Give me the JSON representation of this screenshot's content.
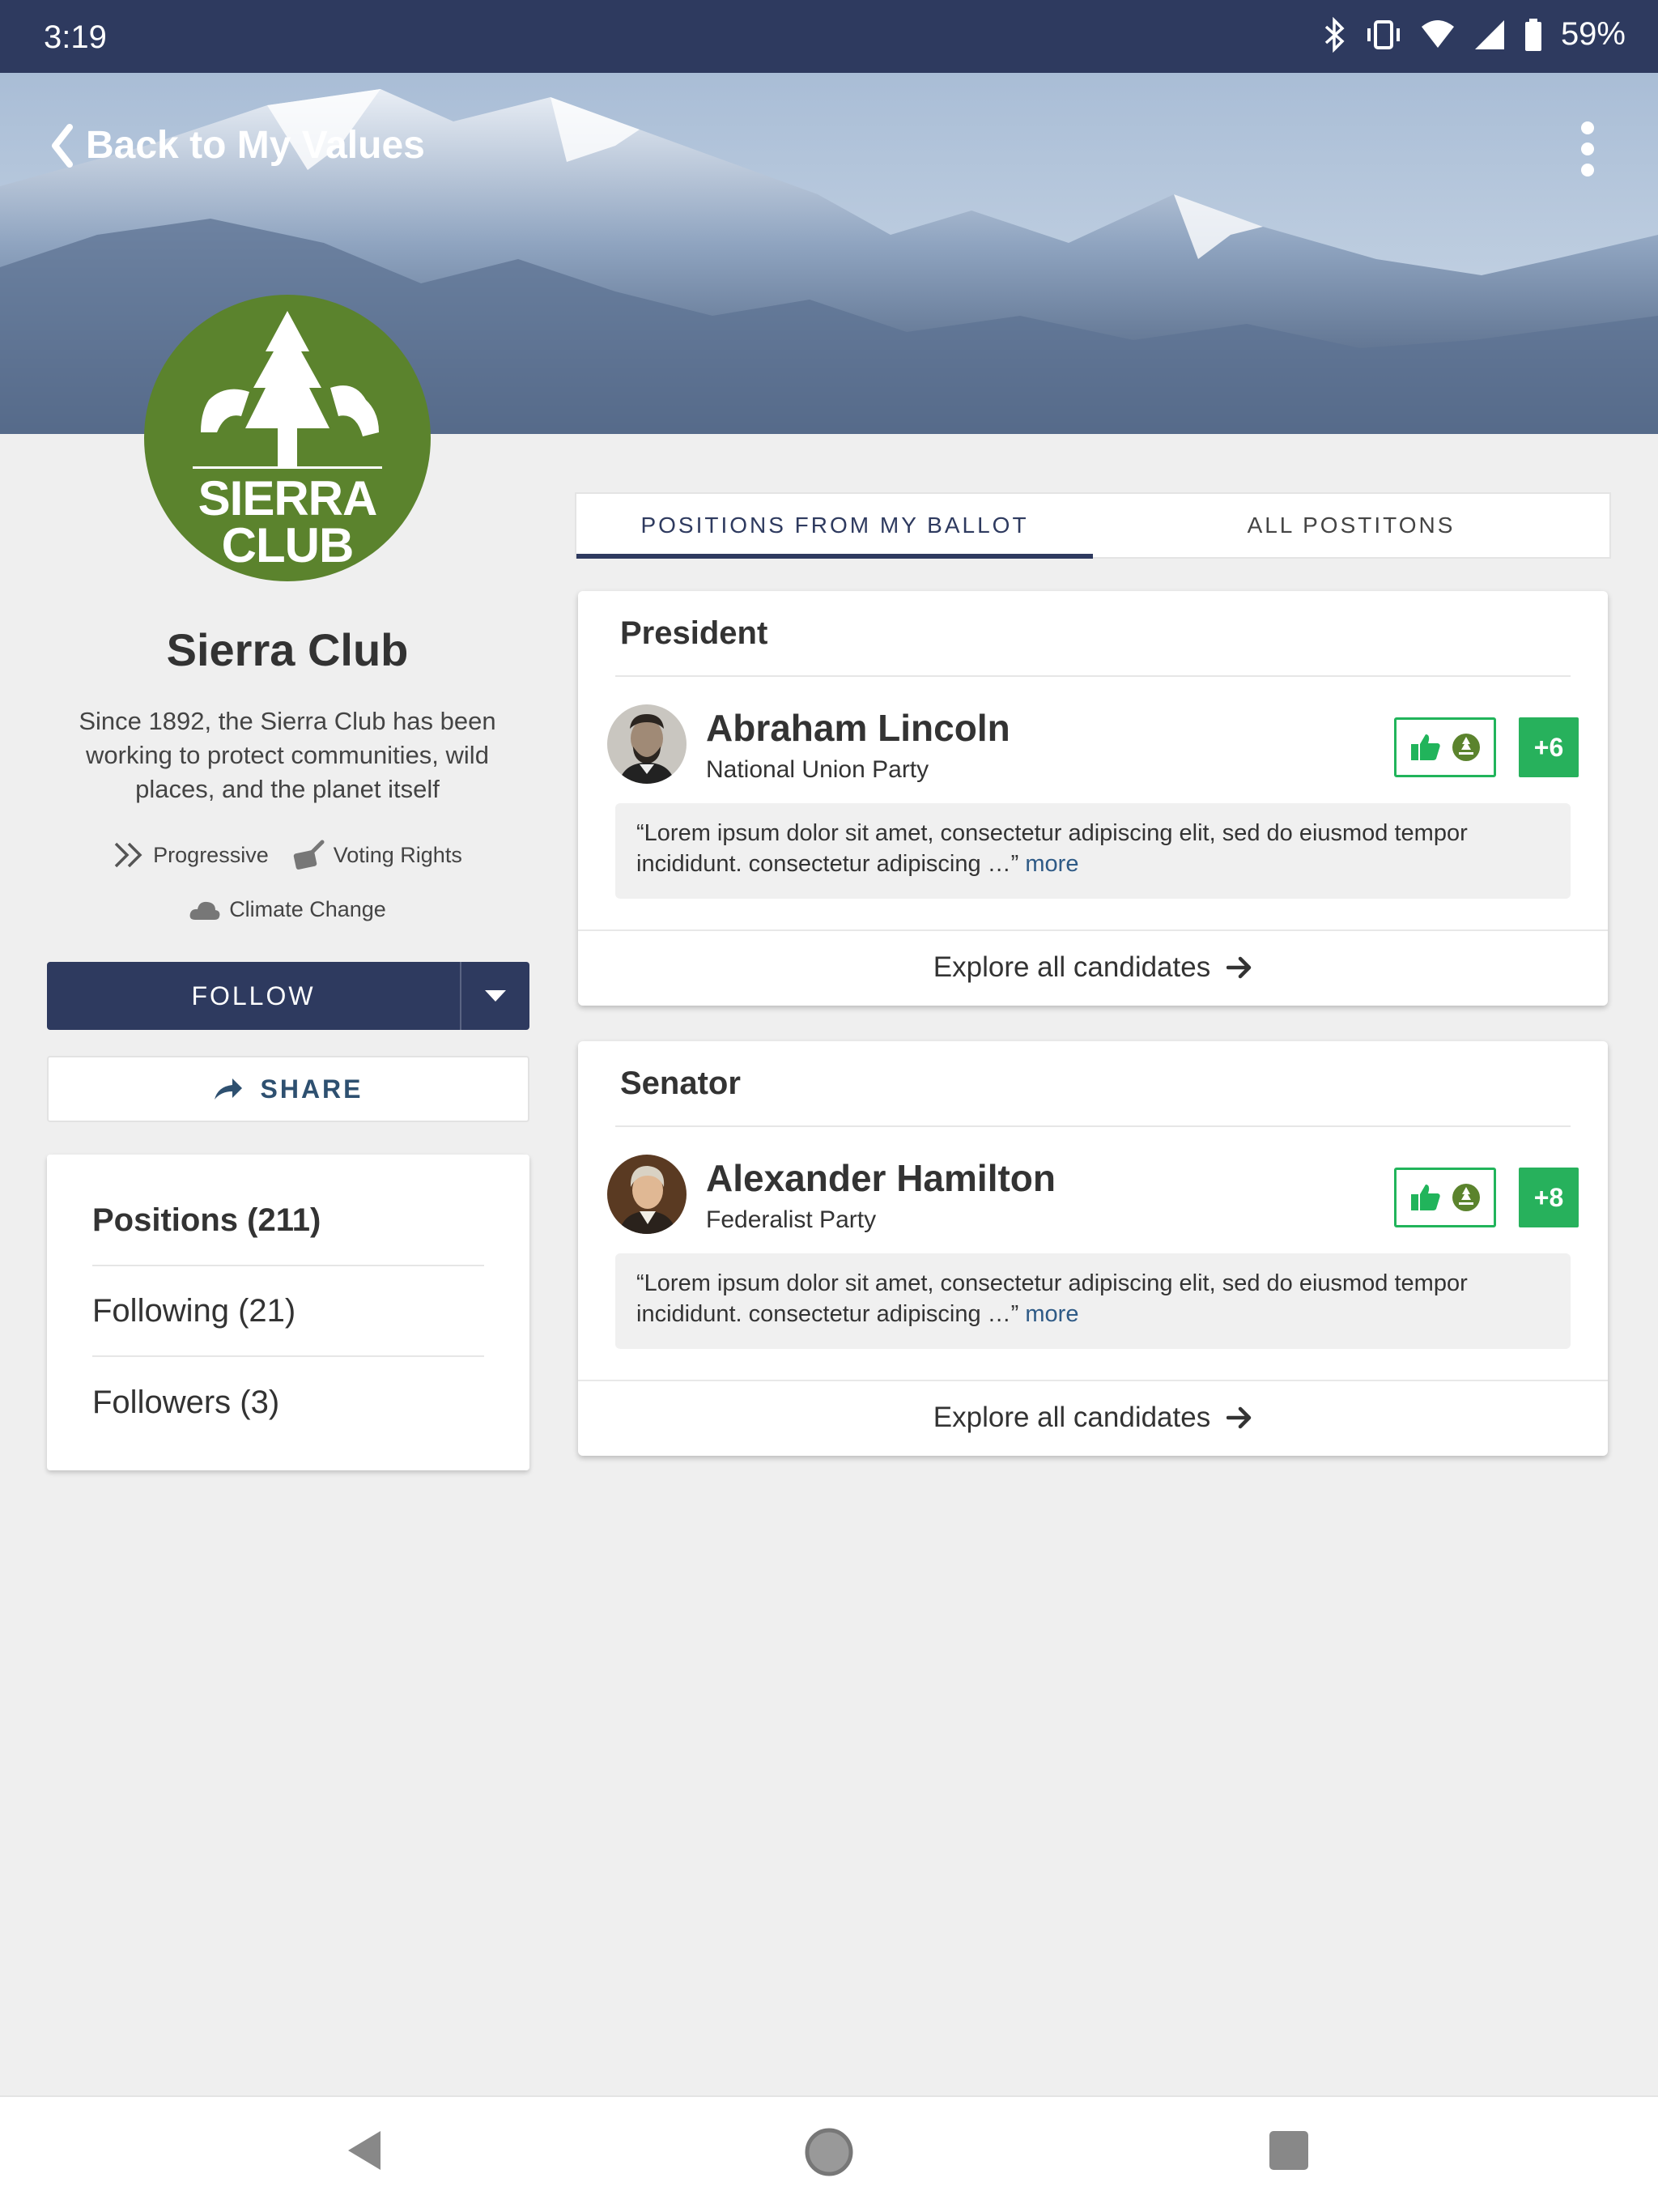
{
  "status_bar": {
    "time": "3:19",
    "battery": "59%"
  },
  "header": {
    "back_label": "Back to My Values"
  },
  "logo": {
    "line1": "SIERRA",
    "line2": "CLUB",
    "color": "#5b832d"
  },
  "organization": {
    "name": "Sierra Club",
    "description": "Since 1892, the Sierra Club has been working to protect communities, wild places, and the planet itself",
    "tags": [
      {
        "label": "Progressive",
        "icon": "double-chevron-icon"
      },
      {
        "label": "Voting Rights",
        "icon": "ballot-pen-icon"
      },
      {
        "label": "Climate Change",
        "icon": "cloud-icon"
      }
    ]
  },
  "actions": {
    "follow_label": "FOLLOW",
    "share_label": "SHARE"
  },
  "stats": {
    "positions": "Positions (211)",
    "following": "Following (21)",
    "followers": "Followers (3)"
  },
  "tabs": [
    {
      "label": "POSITIONS FROM MY BALLOT",
      "active": true
    },
    {
      "label": "ALL POSTITONS",
      "active": false
    }
  ],
  "races": [
    {
      "office": "President",
      "candidate": "Abraham Lincoln",
      "party": "National Union Party",
      "score": "+6",
      "quote": "“Lorem ipsum dolor sit amet, consectetur adipiscing elit, sed do eiusmod tempor incididunt.  consectetur adipiscing …”",
      "more": "more",
      "explore": "Explore all candidates"
    },
    {
      "office": "Senator",
      "candidate": "Alexander Hamilton",
      "party": "Federalist Party",
      "score": "+8",
      "quote": "“Lorem ipsum dolor sit amet, consectetur adipiscing elit, sed do eiusmod tempor incididunt.  consectetur adipiscing …”",
      "more": "more",
      "explore": "Explore all candidates"
    }
  ],
  "colors": {
    "navy": "#2e3a5f",
    "green": "#27b15c",
    "brand_green": "#5b832d"
  }
}
